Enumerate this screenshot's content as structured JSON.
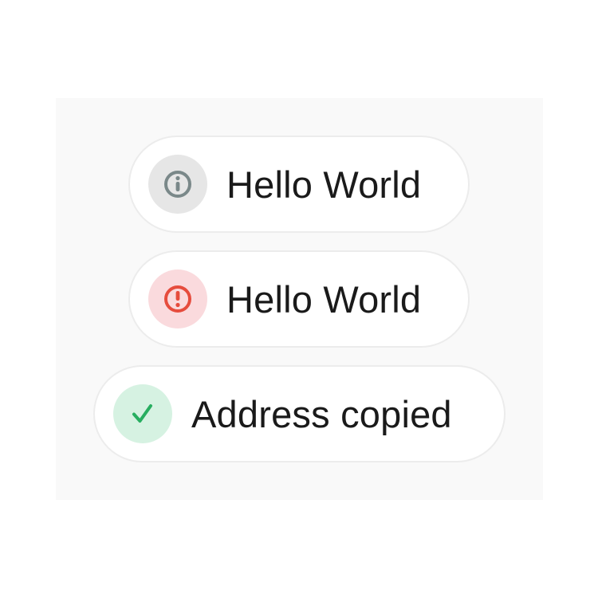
{
  "toasts": [
    {
      "variant": "info",
      "icon": "info-circle-icon",
      "icon_color": "#7a8889",
      "badge_color": "#e6e6e6",
      "message": "Hello World"
    },
    {
      "variant": "error",
      "icon": "exclamation-circle-icon",
      "icon_color": "#e64c3d",
      "badge_color": "#fadadd",
      "message": "Hello World"
    },
    {
      "variant": "success",
      "icon": "check-icon",
      "icon_color": "#27ae60",
      "badge_color": "#d6f2e2",
      "message": "Address copied"
    }
  ]
}
